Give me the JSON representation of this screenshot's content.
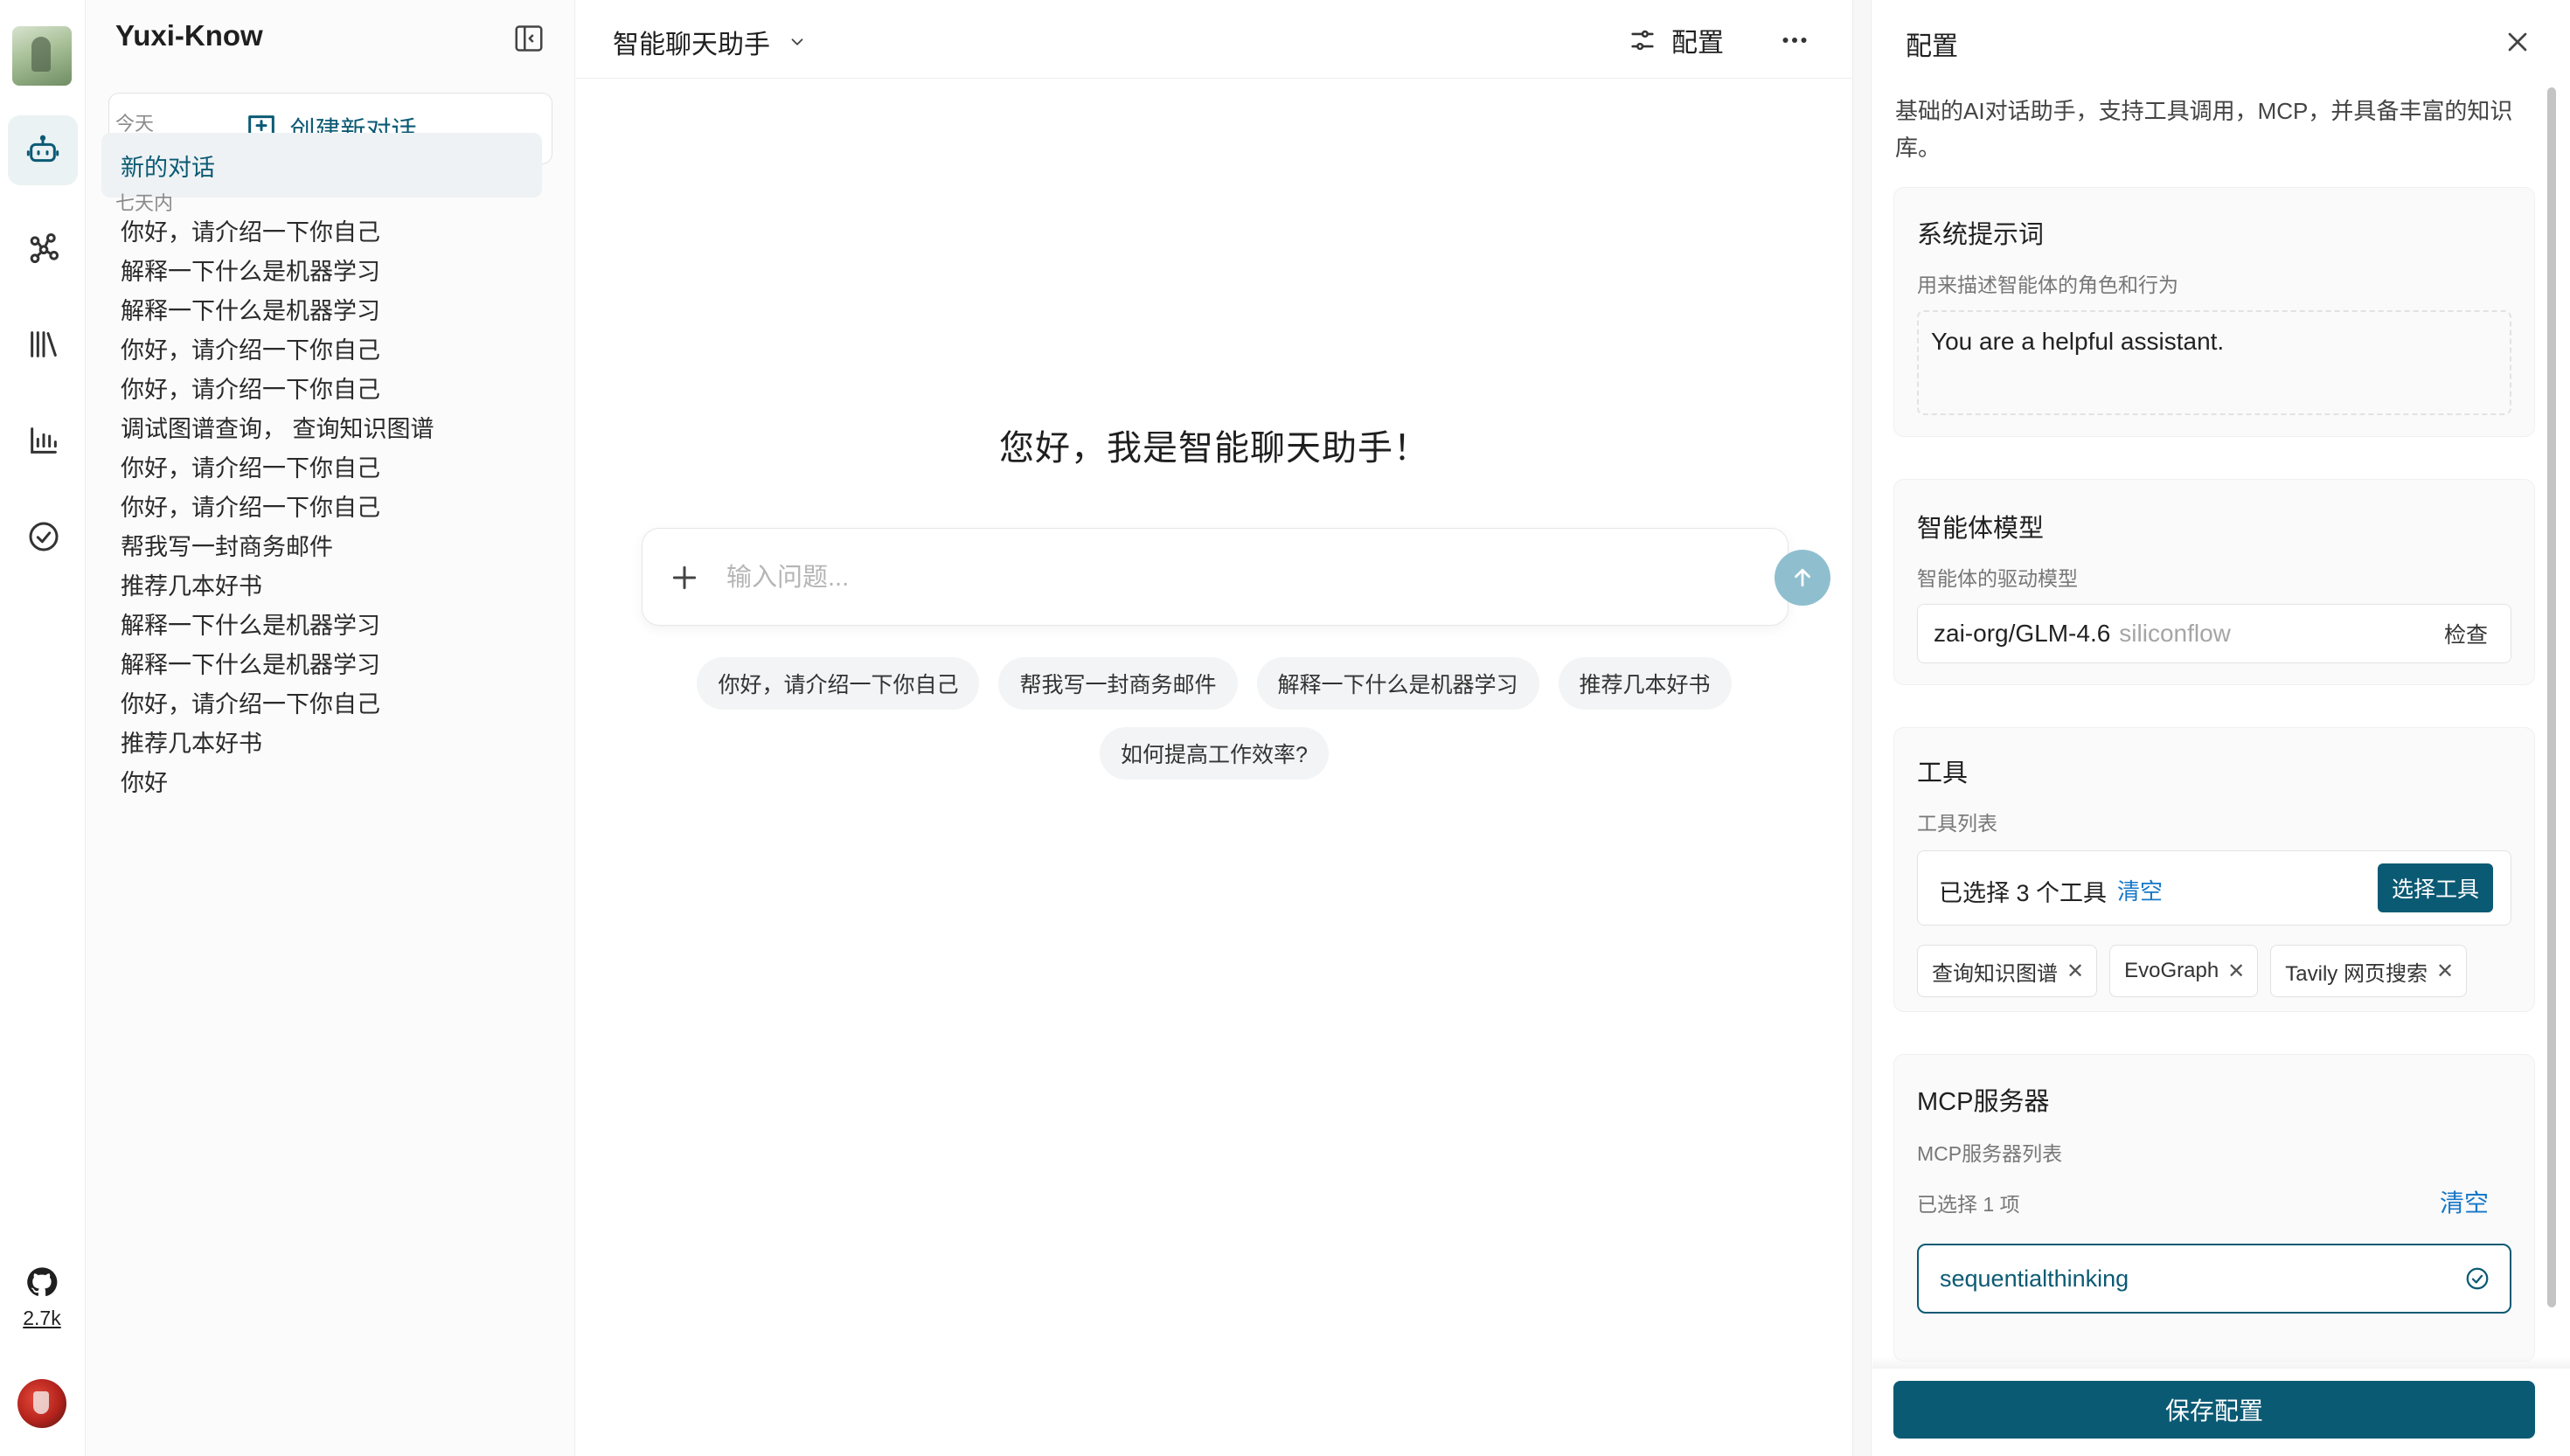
{
  "app": {
    "brand": "Yuxi-Know",
    "accent": "#0b5a74"
  },
  "rail": {
    "items": [
      {
        "name": "agent-icon",
        "active": true
      },
      {
        "name": "graph-icon",
        "active": false
      },
      {
        "name": "library-icon",
        "active": false
      },
      {
        "name": "chart-icon",
        "active": false
      },
      {
        "name": "check-circle-icon",
        "active": false
      }
    ],
    "github_stars": "2.7k"
  },
  "sidebar": {
    "new_chat_label": "创建新对话",
    "today_label": "今天",
    "today_items": [
      {
        "title": "新的对话"
      }
    ],
    "week_label": "七天内",
    "week_items": [
      {
        "title": "你好，请介绍一下你自己"
      },
      {
        "title": "解释一下什么是机器学习"
      },
      {
        "title": "解释一下什么是机器学习"
      },
      {
        "title": "你好，请介绍一下你自己"
      },
      {
        "title": "你好，请介绍一下你自己"
      },
      {
        "title": "调试图谱查询， 查询知识图谱"
      },
      {
        "title": "你好，请介绍一下你自己"
      },
      {
        "title": "你好，请介绍一下你自己"
      },
      {
        "title": "帮我写一封商务邮件"
      },
      {
        "title": "推荐几本好书"
      },
      {
        "title": "解释一下什么是机器学习"
      },
      {
        "title": "解释一下什么是机器学习"
      },
      {
        "title": "你好，请介绍一下你自己"
      },
      {
        "title": "推荐几本好书"
      },
      {
        "title": "你好"
      }
    ]
  },
  "main": {
    "agent_name": "智能聊天助手",
    "config_label": "配置",
    "greeting": "您好，我是智能聊天助手！",
    "input_placeholder": "输入问题...",
    "suggestions": [
      "你好，请介绍一下你自己",
      "帮我写一封商务邮件",
      "解释一下什么是机器学习",
      "推荐几本好书",
      "如何提高工作效率?"
    ]
  },
  "config": {
    "title": "配置",
    "description": "基础的AI对话助手，支持工具调用，MCP，并具备丰富的知识库。",
    "system_prompt": {
      "title": "系统提示词",
      "subtitle": "用来描述智能体的角色和行为",
      "value": "You are a helpful assistant."
    },
    "model": {
      "title": "智能体模型",
      "subtitle": "智能体的驱动模型",
      "name": "zai-org/GLM-4.6",
      "provider": "siliconflow",
      "check_label": "检查"
    },
    "tools": {
      "title": "工具",
      "subtitle": "工具列表",
      "selected_text": "已选择 3 个工具",
      "clear_label": "清空",
      "select_label": "选择工具",
      "tags": [
        "查询知识图谱",
        "EvoGraph",
        "Tavily 网页搜索"
      ]
    },
    "mcp": {
      "title": "MCP服务器",
      "subtitle": "MCP服务器列表",
      "selected_text": "已选择 1 项",
      "clear_label": "清空",
      "items": [
        "sequentialthinking"
      ]
    },
    "save_label": "保存配置"
  }
}
